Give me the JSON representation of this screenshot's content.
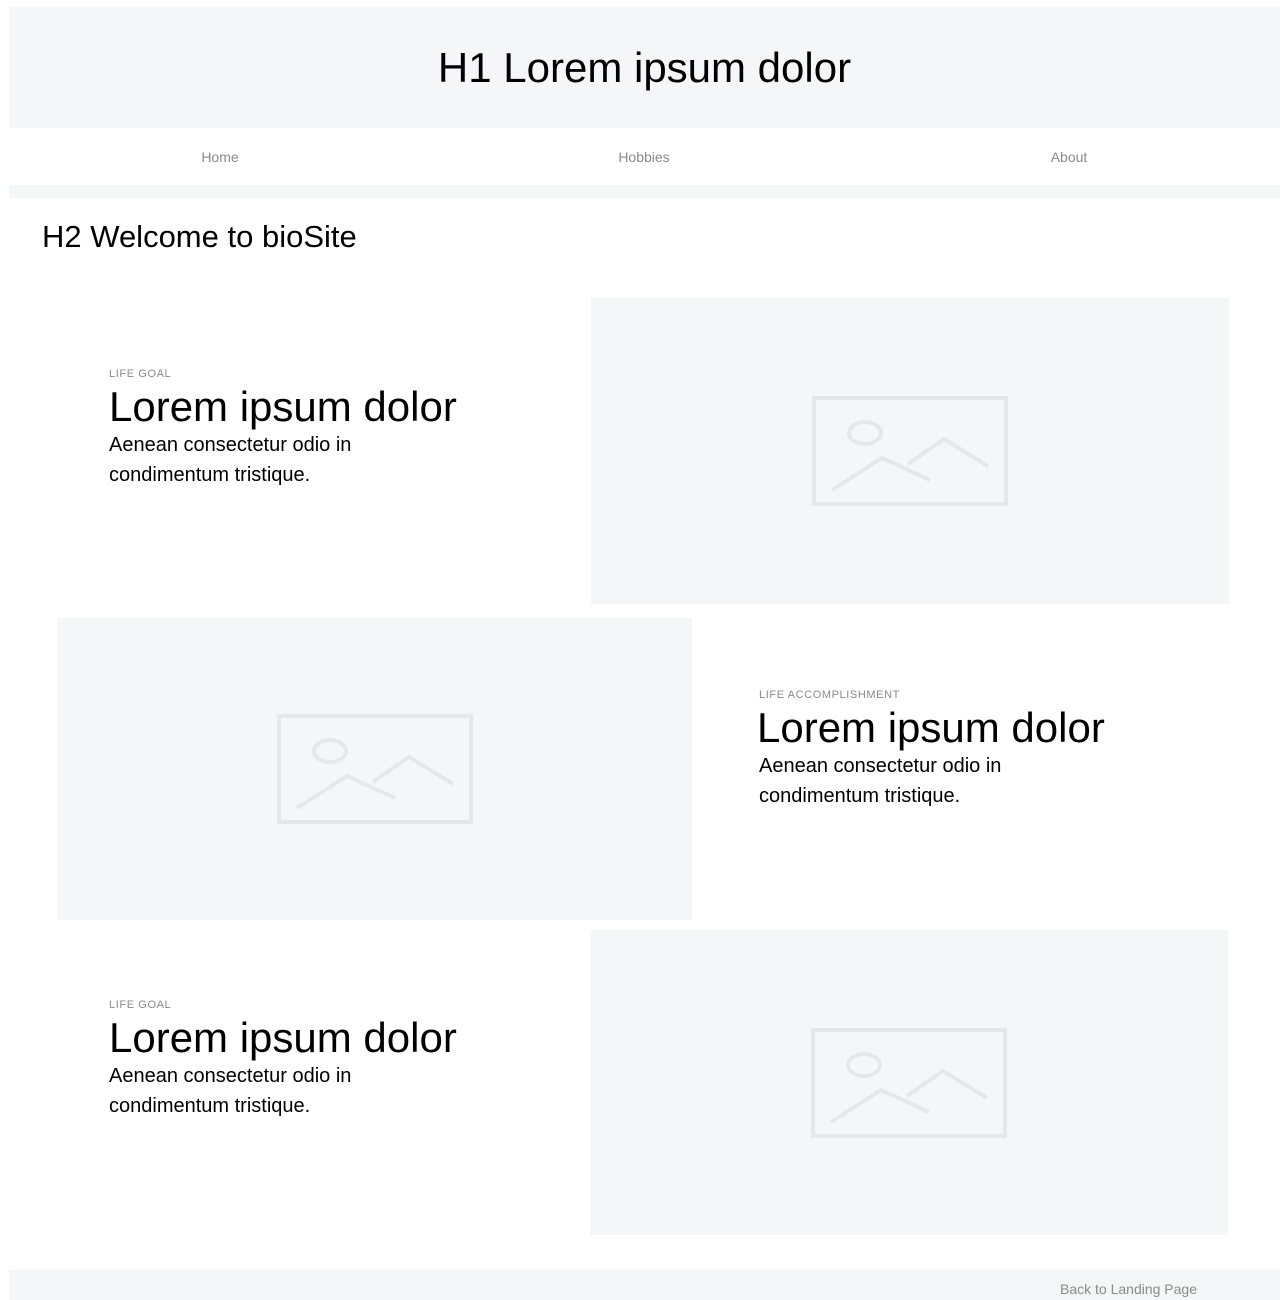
{
  "header": {
    "title": "H1 Lorem ipsum dolor"
  },
  "nav": {
    "items": [
      {
        "label": "Home"
      },
      {
        "label": "Hobbies"
      },
      {
        "label": "About"
      }
    ]
  },
  "main": {
    "welcome": "H2 Welcome to bioSite",
    "features": [
      {
        "eyebrow": "LIFE GOAL",
        "title": "Lorem ipsum dolor",
        "description": "Aenean consectetur odio in condimentum tristique.",
        "image_icon": "image-placeholder-icon"
      },
      {
        "eyebrow": "LIFE ACCOMPLISHMENT",
        "title": "Lorem ipsum dolor",
        "description": "Aenean consectetur odio in condimentum tristique.",
        "image_icon": "image-placeholder-icon"
      },
      {
        "eyebrow": "LIFE GOAL",
        "title": "Lorem ipsum dolor",
        "description": "Aenean consectetur odio in condimentum tristique.",
        "image_icon": "image-placeholder-icon"
      }
    ]
  },
  "footer": {
    "link_label": "Back to Landing Page"
  },
  "colors": {
    "panel_background": "#f5f6f8",
    "muted_text": "#8a8a8a",
    "placeholder_stroke": "#e6e7e9"
  }
}
